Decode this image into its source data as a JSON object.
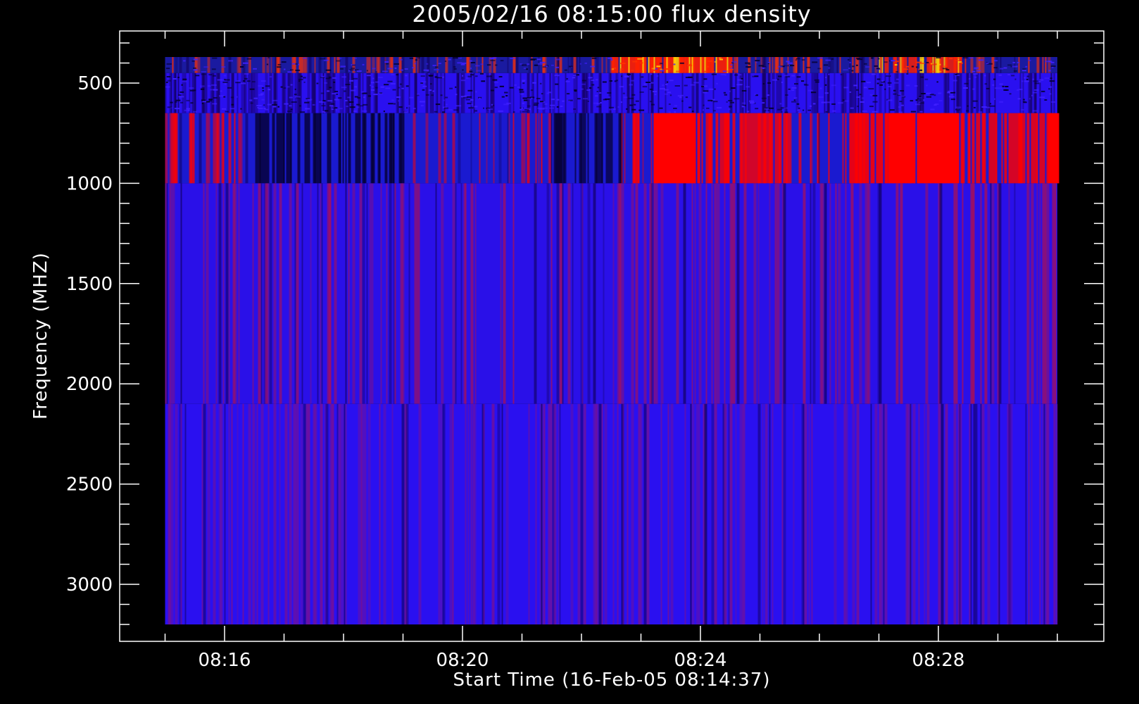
{
  "chart_data": {
    "type": "heatmap",
    "title": "2005/02/16 08:15:00 flux density",
    "xlabel": "Start Time (16-Feb-05 08:14:37)",
    "ylabel": "Frequency (MHZ)",
    "x_unit": "time",
    "x_range": [
      "08:14:37",
      "08:30:00"
    ],
    "x_ticks": [
      "08:16",
      "08:20",
      "08:24",
      "08:28"
    ],
    "x_tick_minutes": [
      16,
      20,
      24,
      28
    ],
    "x_minor_tick_minutes": [
      15,
      16,
      17,
      18,
      19,
      20,
      21,
      22,
      23,
      24,
      25,
      26,
      27,
      28,
      29,
      30
    ],
    "y_range": [
      300,
      3300
    ],
    "y_inverted": true,
    "y_ticks": [
      500,
      1000,
      1500,
      2000,
      2500,
      3000
    ],
    "y_minor_step": 100,
    "data_extent": {
      "time_start": "08:15:00",
      "time_end": "08:30:00",
      "freq_min": 370,
      "freq_max": 3200
    },
    "colormap": {
      "low": "#000000",
      "mid_low": "#0000ff",
      "mid": "#8a1070",
      "high": "#ff0000",
      "peak": "#ffcc00"
    },
    "bands": [
      {
        "freq_from": 370,
        "freq_to": 450,
        "base": "#1a1aa0",
        "stripe": "#ff3000",
        "note_level": "mixed"
      },
      {
        "freq_from": 450,
        "freq_to": 650,
        "base": "#2a10f0",
        "stripe": "#140060",
        "note_level": "uniform"
      },
      {
        "freq_from": 650,
        "freq_to": 1000,
        "base": "#1a1ad0",
        "stripe": "#ff0000",
        "note_level": "high"
      },
      {
        "freq_from": 1000,
        "freq_to": 2100,
        "base": "#2a10e8",
        "stripe": "#a01060",
        "note_level": "medium"
      },
      {
        "freq_from": 2100,
        "freq_to": 3200,
        "base": "#2a10f0",
        "stripe": "#7a1090",
        "note_level": "medium"
      }
    ],
    "hot_regions": [
      {
        "band": 2,
        "time_from": "08:22:50",
        "time_to": "08:23:00",
        "level": 0.7
      },
      {
        "band": 2,
        "time_from": "08:23:10",
        "time_to": "08:24:00",
        "level": 1.0
      },
      {
        "band": 2,
        "time_from": "08:24:00",
        "time_to": "08:25:30",
        "level": 0.55
      },
      {
        "band": 2,
        "time_from": "08:26:30",
        "time_to": "08:27:10",
        "level": 0.75
      },
      {
        "band": 2,
        "time_from": "08:27:10",
        "time_to": "08:28:20",
        "level": 1.0
      },
      {
        "band": 2,
        "time_from": "08:28:20",
        "time_to": "08:29:50",
        "level": 0.6
      },
      {
        "band": 2,
        "time_from": "08:29:50",
        "time_to": "08:30:00",
        "level": 1.0
      },
      {
        "band": 0,
        "time_from": "08:22:30",
        "time_to": "08:24:30",
        "level": 0.8
      },
      {
        "band": 0,
        "time_from": "08:27:00",
        "time_to": "08:28:30",
        "level": 0.6
      }
    ],
    "dark_regions": [
      {
        "band": 2,
        "time_from": "08:16:30",
        "time_to": "08:19:00",
        "level": 0.6
      },
      {
        "band": 2,
        "time_from": "08:21:30",
        "time_to": "08:22:40",
        "level": 0.4
      }
    ],
    "colors": {
      "background": "#000000",
      "axes": "#ffffff",
      "text": "#ffffff"
    }
  }
}
